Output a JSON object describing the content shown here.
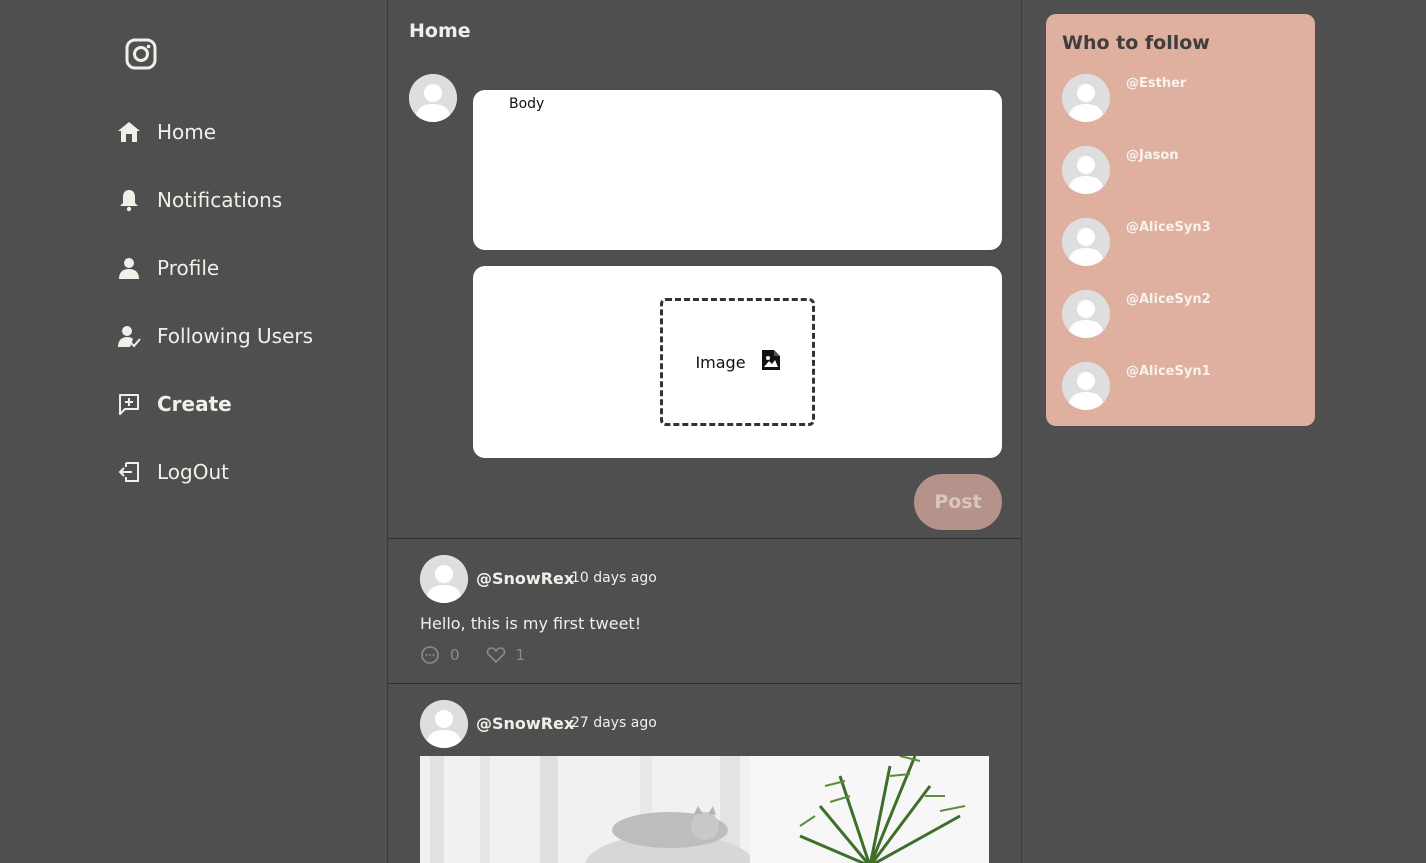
{
  "nav": {
    "items": [
      {
        "label": "Home",
        "icon": "home-icon",
        "active": false
      },
      {
        "label": "Notifications",
        "icon": "bell-icon",
        "active": false
      },
      {
        "label": "Profile",
        "icon": "user-icon",
        "active": false
      },
      {
        "label": "Following Users",
        "icon": "user-check-icon",
        "active": false
      },
      {
        "label": "Create",
        "icon": "add-message-icon",
        "active": true
      },
      {
        "label": "LogOut",
        "icon": "logout-icon",
        "active": false
      }
    ]
  },
  "main": {
    "title": "Home",
    "compose": {
      "body_placeholder": "Body",
      "image_label": "Image",
      "post_label": "Post"
    },
    "tweets": [
      {
        "handle": "@SnowRex",
        "time": "10 days ago",
        "text": "Hello, this is my first tweet!",
        "replies": "0",
        "likes": "1"
      },
      {
        "handle": "@SnowRex",
        "time": "27 days ago"
      }
    ]
  },
  "who_to_follow": {
    "title": "Who to follow",
    "users": [
      "@Esther",
      "@Jason",
      "@AliceSyn3",
      "@AliceSyn2",
      "@AliceSyn1"
    ]
  },
  "colors": {
    "background": "#4f4f4f",
    "follow_card": "#dfaf9f",
    "post_button": "#b5938a",
    "text": "#f2efe9"
  }
}
